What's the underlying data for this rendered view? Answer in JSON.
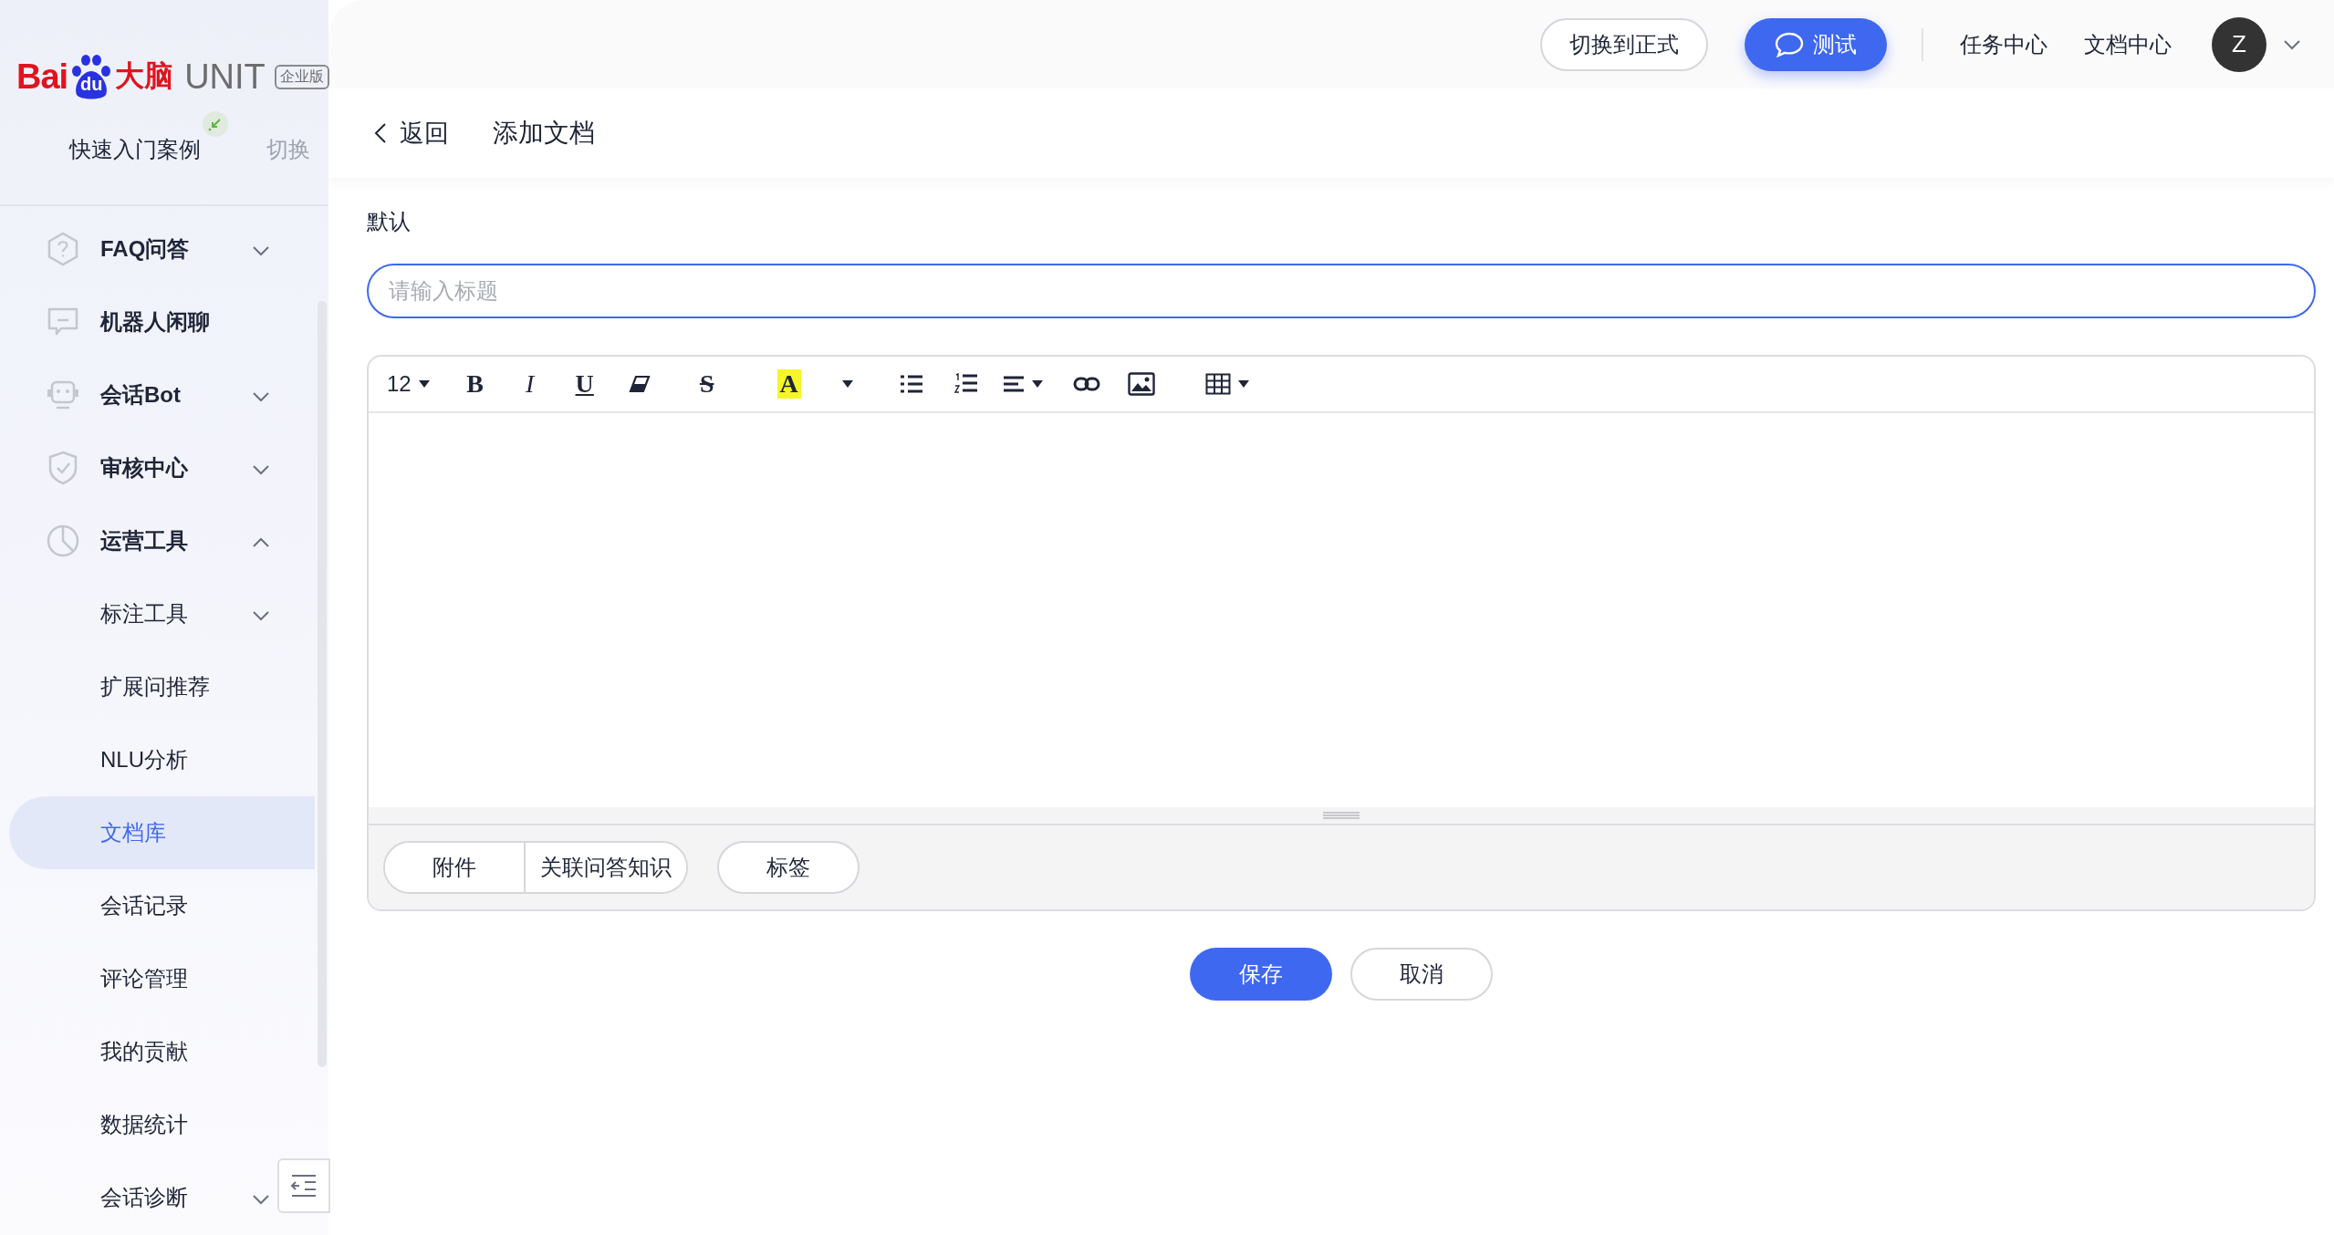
{
  "logo": {
    "brand_left": "Bai",
    "brand_paw": "du",
    "brand_cn": "大脑",
    "product": "UNIT",
    "edition": "企业版"
  },
  "project": {
    "name": "快速入门案例",
    "pinned": true,
    "switch": "切换"
  },
  "sidebar": {
    "items": [
      {
        "label": "FAQ问答",
        "kind": "group",
        "expanded": false,
        "selected": false
      },
      {
        "label": "机器人闲聊",
        "kind": "link",
        "selected": false
      },
      {
        "label": "会话Bot",
        "kind": "group",
        "expanded": false,
        "selected": false
      },
      {
        "label": "审核中心",
        "kind": "group",
        "expanded": false,
        "selected": false
      },
      {
        "label": "运营工具",
        "kind": "group",
        "expanded": true,
        "selected": false,
        "children": [
          {
            "label": "标注工具",
            "kind": "group",
            "expanded": false,
            "selected": false
          },
          {
            "label": "扩展问推荐",
            "kind": "link",
            "selected": false
          },
          {
            "label": "NLU分析",
            "kind": "link",
            "selected": false
          },
          {
            "label": "文档库",
            "kind": "link",
            "selected": true
          },
          {
            "label": "会话记录",
            "kind": "link",
            "selected": false
          },
          {
            "label": "评论管理",
            "kind": "link",
            "selected": false
          },
          {
            "label": "我的贡献",
            "kind": "link",
            "selected": false
          },
          {
            "label": "数据统计",
            "kind": "link",
            "selected": false
          },
          {
            "label": "会话诊断",
            "kind": "group",
            "expanded": false,
            "selected": false
          }
        ]
      }
    ]
  },
  "header": {
    "switch_button": "切换到正式",
    "test_button": "测试",
    "links": [
      "任务中心",
      "文档中心"
    ],
    "avatar": "Z"
  },
  "page": {
    "back": "返回",
    "title": "添加文档"
  },
  "form": {
    "category": "默认",
    "title_field": {
      "placeholder": "请输入标题"
    },
    "toolbar": {
      "font_size": "12",
      "bold": "B",
      "italic": "I",
      "underline": "U",
      "strike": "S",
      "highlight": "A"
    },
    "attach_tabs": [
      "附件",
      "关联问答知识"
    ],
    "tag_button": "标签"
  },
  "actions": [
    {
      "label": "保存",
      "kind": "primary"
    },
    {
      "label": "取消",
      "kind": "secondary"
    }
  ]
}
